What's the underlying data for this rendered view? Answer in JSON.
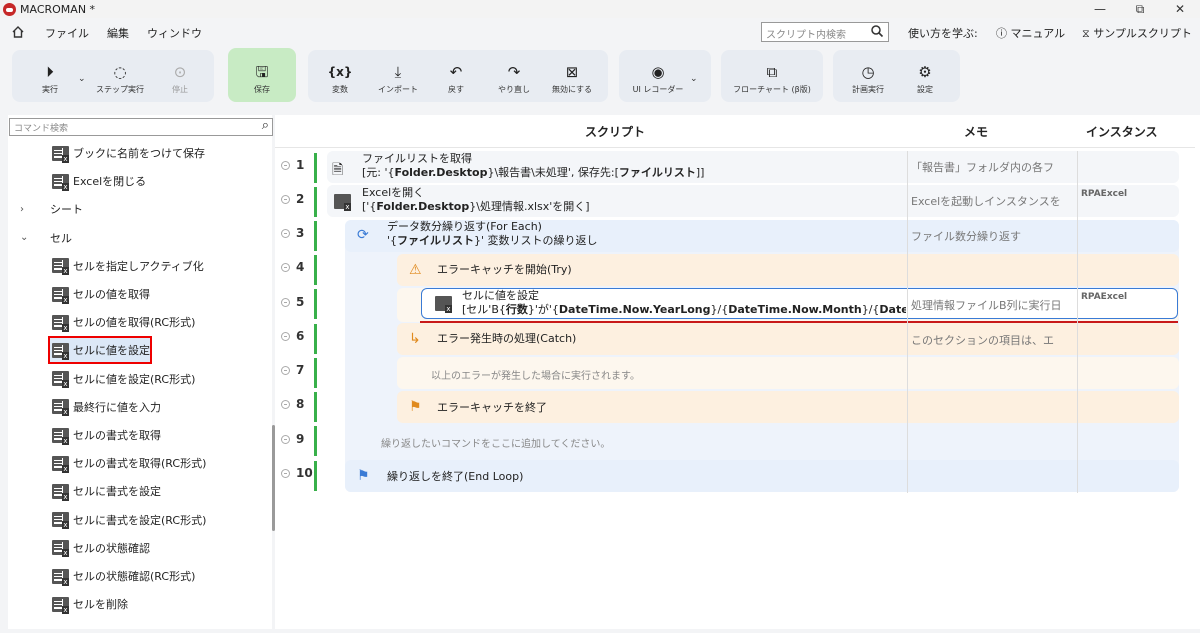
{
  "app": {
    "title": "MACROMAN *"
  },
  "window_buttons": {
    "minimize": "—",
    "restore": "⧉",
    "close": "✕"
  },
  "menu": {
    "items": [
      "ファイル",
      "編集",
      "ウィンドウ"
    ]
  },
  "top_search": {
    "placeholder": "スクリプト内検索"
  },
  "help": {
    "learn": "使い方を学ぶ:",
    "manual": "マニュアル",
    "samples": "サンプルスクリプト"
  },
  "ribbon": {
    "run": "実行",
    "step_run": "ステップ実行",
    "stop": "停止",
    "save": "保存",
    "variables": "変数",
    "import": "インポート",
    "undo": "戻す",
    "redo": "やり直し",
    "disable": "無効にする",
    "ui_recorder": "UI レコーダー",
    "flowchart": "フローチャート (β版)",
    "schedule": "計画実行",
    "settings": "設定"
  },
  "sidebar": {
    "search_placeholder": "コマンド検索",
    "items": [
      {
        "label": "ブックに名前をつけて保存"
      },
      {
        "label": "Excelを閉じる"
      },
      {
        "label": "シート",
        "type": "category",
        "expanded": false
      },
      {
        "label": "セル",
        "type": "category",
        "expanded": true
      },
      {
        "label": "セルを指定しアクティブ化"
      },
      {
        "label": "セルの値を取得"
      },
      {
        "label": "セルの値を取得(RC形式)"
      },
      {
        "label": "セルに値を設定",
        "selected": true
      },
      {
        "label": "セルに値を設定(RC形式)"
      },
      {
        "label": "最終行に値を入力"
      },
      {
        "label": "セルの書式を取得"
      },
      {
        "label": "セルの書式を取得(RC形式)"
      },
      {
        "label": "セルに書式を設定"
      },
      {
        "label": "セルに書式を設定(RC形式)"
      },
      {
        "label": "セルの状態確認"
      },
      {
        "label": "セルの状態確認(RC形式)"
      },
      {
        "label": "セルを削除"
      }
    ]
  },
  "script": {
    "headers": {
      "script": "スクリプト",
      "memo": "メモ",
      "instance": "インスタンス"
    },
    "rows": [
      {
        "num": "1",
        "title": "ファイルリストを取得",
        "detail_pre": "[元: '{",
        "detail_b1": "Folder.Desktop",
        "detail_mid": "}\\報告書\\未処理', 保存先:[",
        "detail_b2": "ファイルリスト",
        "detail_post": "]]",
        "memo": "「報告書」フォルダ内の各フ",
        "instance": ""
      },
      {
        "num": "2",
        "title": "Excelを開く",
        "detail_pre": "['{",
        "detail_b1": "Folder.Desktop",
        "detail_mid": "}\\処理情報.xlsx'を開く]",
        "detail_b2": "",
        "detail_post": "",
        "memo": "Excelを起動しインスタンスを",
        "instance": "RPAExcel"
      },
      {
        "num": "3",
        "title": "データ数分繰り返す(For Each)",
        "detail_pre": "'{",
        "detail_b1": "ファイルリスト",
        "detail_mid": "}' 変数リストの繰り返し",
        "detail_b2": "",
        "detail_post": "",
        "memo": "ファイル数分繰り返す",
        "instance": ""
      },
      {
        "num": "4",
        "title": "エラーキャッチを開始(Try)",
        "memo": "",
        "instance": ""
      },
      {
        "num": "5",
        "title": "セルに値を設定",
        "detail_pre": "[セル'B{",
        "detail_b1": "行数",
        "detail_mid": "}'が'{",
        "detail_b2": "DateTime.Now.YearLong",
        "detail_post": "}/{",
        "detail_b3": "DateTime.Now.Month",
        "detail_post2": "}/{",
        "detail_b4": "DateTime.Now",
        "memo": "処理情報ファイルB列に実行日",
        "instance": "RPAExcel"
      },
      {
        "num": "6",
        "title": "エラー発生時の処理(Catch)",
        "memo": "このセクションの項目は、エ",
        "instance": ""
      },
      {
        "num": "7",
        "hint": "以上のエラーが発生した場合に実行されます。",
        "memo": "",
        "instance": ""
      },
      {
        "num": "8",
        "title": "エラーキャッチを終了",
        "memo": "",
        "instance": ""
      },
      {
        "num": "9",
        "hint": "繰り返したいコマンドをここに追加してください。",
        "memo": "",
        "instance": ""
      },
      {
        "num": "10",
        "title": "繰り返しを終了(End Loop)",
        "memo": "",
        "instance": ""
      }
    ]
  },
  "colors": {
    "save_group": "#c8ebc4",
    "blue_block": "#e8f0fb",
    "orange_block": "#fdf0e0",
    "highlight_red": "#e00000",
    "selection_blue": "#3a7bd5"
  }
}
